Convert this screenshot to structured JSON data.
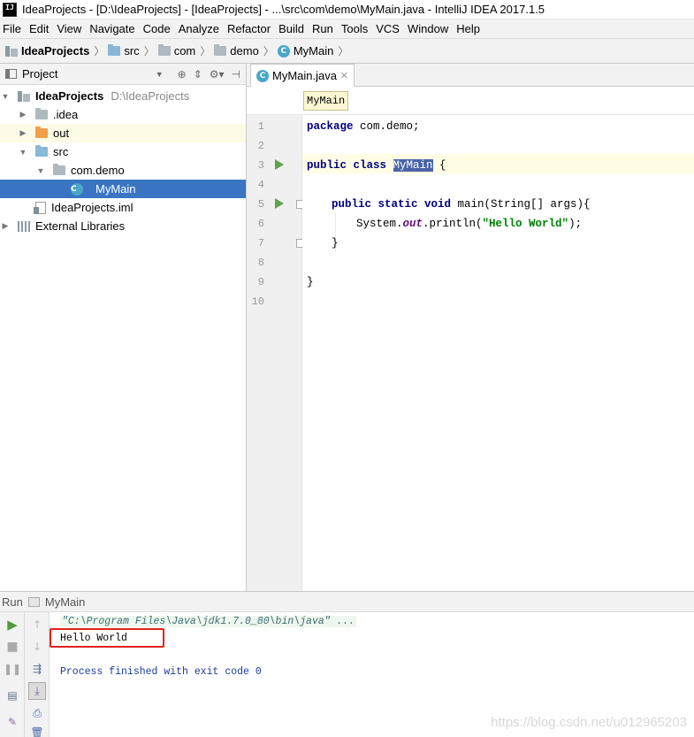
{
  "window": {
    "app_icon": "IJ",
    "title": "IdeaProjects - [D:\\IdeaProjects] - [IdeaProjects] - ...\\src\\com\\demo\\MyMain.java - IntelliJ IDEA 2017.1.5"
  },
  "menubar": [
    "File",
    "Edit",
    "View",
    "Navigate",
    "Code",
    "Analyze",
    "Refactor",
    "Build",
    "Run",
    "Tools",
    "VCS",
    "Window",
    "Help"
  ],
  "navbar": {
    "crumbs": [
      {
        "label": "IdeaProjects",
        "icon": "project-icon"
      },
      {
        "label": "src",
        "icon": "folder-icon"
      },
      {
        "label": "com",
        "icon": "folder-icon"
      },
      {
        "label": "demo",
        "icon": "folder-icon"
      },
      {
        "label": "MyMain",
        "icon": "class-icon"
      }
    ]
  },
  "project_panel": {
    "title": "Project",
    "tree": {
      "root_label": "IdeaProjects",
      "root_path": "D:\\IdeaProjects",
      "idea": ".idea",
      "out": "out",
      "src": "src",
      "pkg": "com.demo",
      "main_class": "MyMain",
      "iml": "IdeaProjects.iml",
      "ext_libs": "External Libraries"
    }
  },
  "editor": {
    "tab_label": "MyMain.java",
    "tooltip": "MyMain",
    "line_numbers": [
      "1",
      "2",
      "3",
      "4",
      "5",
      "6",
      "7",
      "8",
      "9",
      "10"
    ],
    "code": {
      "l1_kw": "package",
      "l1_rest": " com.demo;",
      "l3_kw": "public class ",
      "l3_cls": "MyMain",
      "l3_rest": " {",
      "l5_kw": "public static void",
      "l5_rest": " main(String[] args){",
      "l6_a": "System.",
      "l6_field": "out",
      "l6_b": ".println(",
      "l6_str": "\"Hello World\"",
      "l6_c": ");",
      "l7": "}",
      "l9": "}"
    }
  },
  "run_panel": {
    "label": "Run",
    "config": "MyMain",
    "console": {
      "cmd": "\"C:\\Program Files\\Java\\jdk1.7.0_80\\bin\\java\" ...",
      "output": "Hello World",
      "exit": "Process finished with exit code 0"
    }
  },
  "watermark": "https://blog.csdn.net/u012965203",
  "colors": {
    "accent_run": "#5fa34a",
    "selection": "#3a75c4",
    "highlight_box": "#e2231a"
  }
}
